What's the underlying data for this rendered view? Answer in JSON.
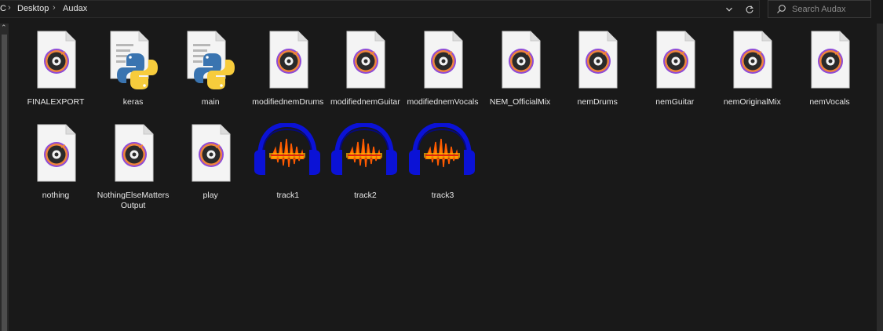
{
  "address_bar": {
    "crumbs": [
      "C",
      "Desktop",
      "Audax"
    ]
  },
  "search": {
    "placeholder": "Search Audax"
  },
  "files": [
    {
      "name": "FINALEXPORT",
      "type": "audio"
    },
    {
      "name": "keras",
      "type": "python"
    },
    {
      "name": "main",
      "type": "python"
    },
    {
      "name": "modifiednemDrums",
      "type": "audio"
    },
    {
      "name": "modifiednemGuitar",
      "type": "audio"
    },
    {
      "name": "modifiednemVocals",
      "type": "audio"
    },
    {
      "name": "NEM_OfficialMix",
      "type": "audio"
    },
    {
      "name": "nemDrums",
      "type": "audio"
    },
    {
      "name": "nemGuitar",
      "type": "audio"
    },
    {
      "name": "nemOriginalMix",
      "type": "audio"
    },
    {
      "name": "nemVocals",
      "type": "audio"
    },
    {
      "name": "nothing",
      "type": "audio"
    },
    {
      "name": "NothingElseMattersOutput",
      "type": "audio"
    },
    {
      "name": "play",
      "type": "audio"
    },
    {
      "name": "track1",
      "type": "audacity"
    },
    {
      "name": "track2",
      "type": "audacity"
    },
    {
      "name": "track3",
      "type": "audacity"
    }
  ],
  "icons": {
    "audio": "audio-file-icon",
    "python": "python-file-icon",
    "audacity": "audacity-project-icon",
    "dropdown": "chevron-down-icon",
    "refresh": "refresh-icon",
    "search": "search-icon",
    "separator": "chevron-right-icon"
  },
  "colors": {
    "background": "#191919",
    "text": "#e6e6e6",
    "audacity_headphones": "#0b12d6",
    "audacity_wave": "#ff6a00"
  }
}
